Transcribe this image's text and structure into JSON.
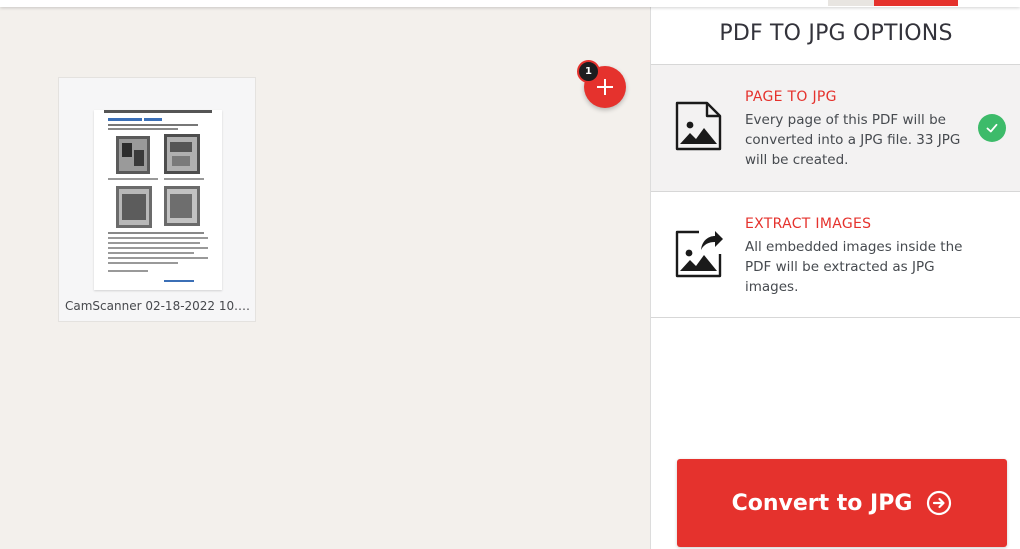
{
  "workspace": {
    "file": {
      "name": "CamScanner 02-18-2022 10.12..",
      "icon": "document-thumbnail"
    },
    "add_button": {
      "icon": "plus-icon",
      "badge_count": "1"
    }
  },
  "sidebar": {
    "title": "PDF TO JPG OPTIONS",
    "options": [
      {
        "title": "PAGE TO JPG",
        "description_prefix": "Every page of this PDF will be converted into a JPG file. ",
        "count": "33",
        "description_suffix": " JPG will be created.",
        "icon": "image-page-icon",
        "selected": true
      },
      {
        "title": "EXTRACT IMAGES",
        "description": "All embedded images inside the PDF will be extracted as JPG images.",
        "icon": "image-extract-icon",
        "selected": false
      }
    ],
    "convert_label": "Convert to JPG",
    "convert_icon": "arrow-circle-right-icon"
  },
  "colors": {
    "accent": "#e5322d",
    "success": "#3dbb6a",
    "workspace_bg": "#f3f0ec"
  }
}
